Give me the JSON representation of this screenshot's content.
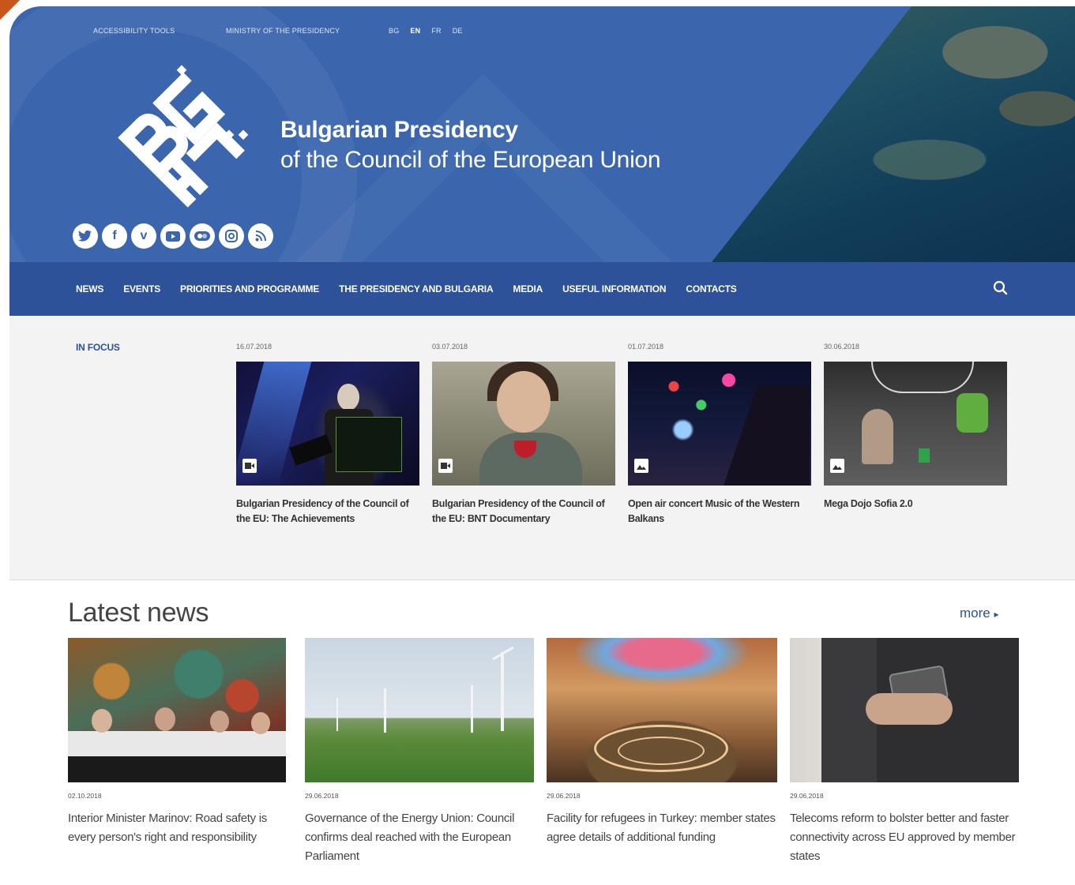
{
  "header": {
    "top_links": [
      "ACCESSIBILITY TOOLS",
      "MINISTRY OF THE PRESIDENCY"
    ],
    "languages": [
      "BG",
      "EN",
      "FR",
      "DE"
    ],
    "active_language": "EN",
    "title_line1": "Bulgarian Presidency",
    "title_line2": "of the Council of the European Union",
    "social_icons": [
      "twitter-icon",
      "facebook-icon",
      "vimeo-icon",
      "youtube-icon",
      "flickr-icon",
      "instagram-icon",
      "rss-icon"
    ],
    "brand_color": "#3b66ad"
  },
  "nav": {
    "items": [
      "NEWS",
      "EVENTS",
      "PRIORITIES AND PROGRAMME",
      "THE PRESIDENCY AND BULGARIA",
      "MEDIA",
      "USEFUL INFORMATION",
      "CONTACTS"
    ],
    "search_icon": "search-icon",
    "color": "#2d5299"
  },
  "in_focus": {
    "label": "IN FOCUS",
    "items": [
      {
        "date": "16.07.2018",
        "title": "Bulgarian Presidency of the Council of the EU: The Achievements",
        "media": "video-icon"
      },
      {
        "date": "03.07.2018",
        "title": "Bulgarian Presidency of the Council of the EU: BNT Documentary",
        "media": "video-icon"
      },
      {
        "date": "01.07.2018",
        "title": "Open air concert Music of the Western Balkans",
        "media": "photo-icon"
      },
      {
        "date": "30.06.2018",
        "title": "Mega Dojo Sofia 2.0",
        "media": "photo-icon"
      }
    ]
  },
  "latest_news": {
    "heading": "Latest news",
    "more": "more",
    "items": [
      {
        "date": "02.10.2018",
        "title": "Interior Minister Marinov: Road safety is every person's right and responsibility"
      },
      {
        "date": "29.06.2018",
        "title": "Governance of the Energy Union: Council confirms deal reached with the European Parliament"
      },
      {
        "date": "29.06.2018",
        "title": "Facility for refugees in Turkey: member states agree details of additional funding"
      },
      {
        "date": "29.06.2018",
        "title": "Telecoms reform to bolster better and faster connectivity across EU approved by member states"
      }
    ]
  }
}
